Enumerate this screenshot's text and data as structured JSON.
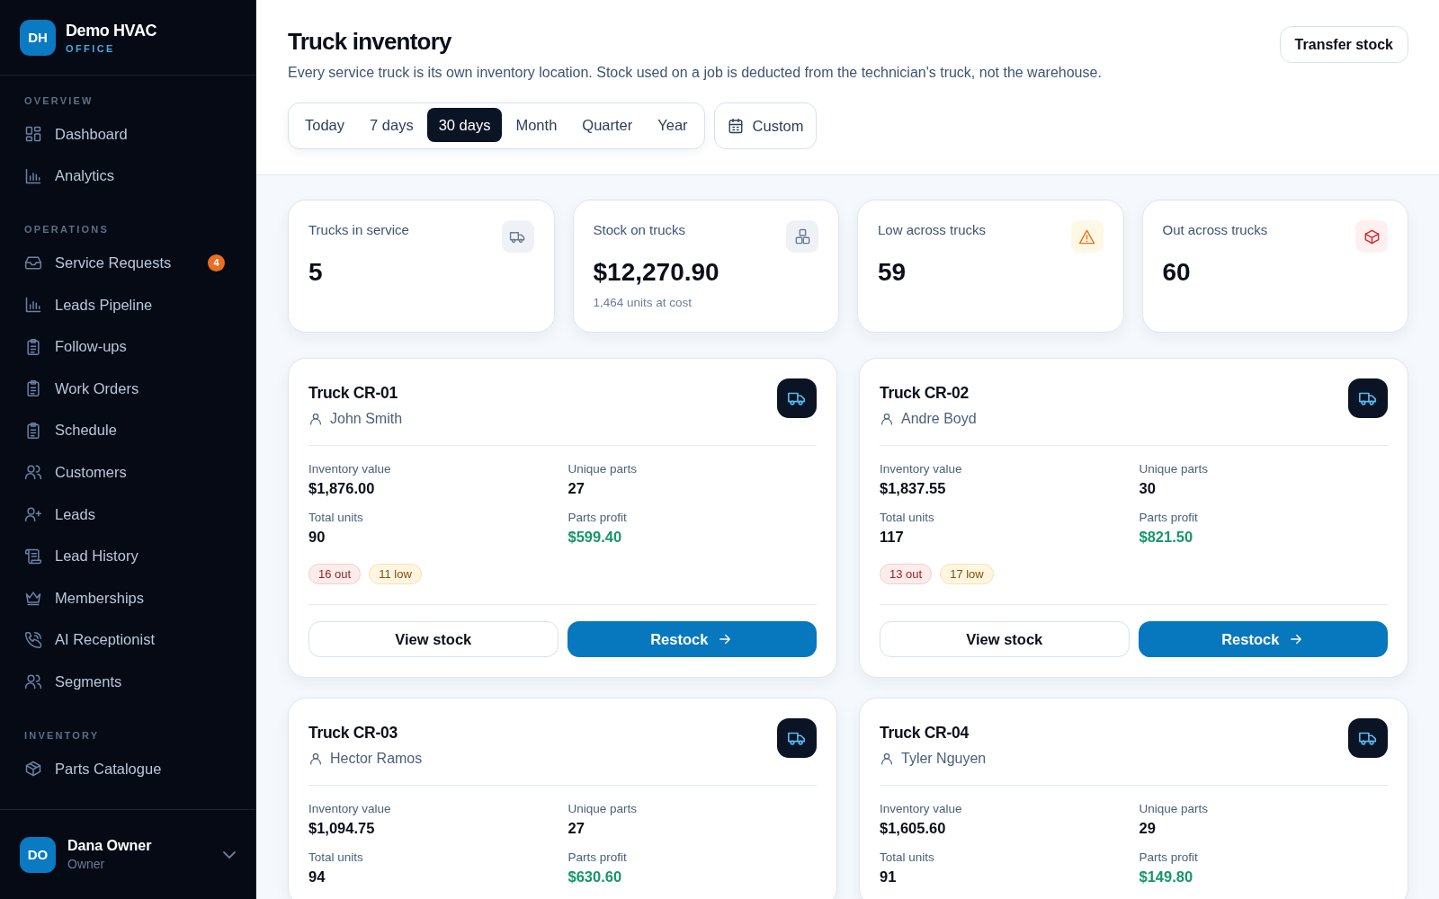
{
  "brand": {
    "initials": "DH",
    "name": "Demo HVAC",
    "subtitle": "OFFICE"
  },
  "sidebar": {
    "sections": [
      {
        "title": "OVERVIEW",
        "items": [
          {
            "label": "Dashboard",
            "kind": "grid"
          },
          {
            "label": "Analytics",
            "kind": "chart"
          }
        ]
      },
      {
        "title": "OPERATIONS",
        "items": [
          {
            "label": "Service Requests",
            "kind": "inbox",
            "badge": "4"
          },
          {
            "label": "Leads Pipeline",
            "kind": "chart"
          },
          {
            "label": "Follow-ups",
            "kind": "clipboard"
          },
          {
            "label": "Work Orders",
            "kind": "clipboard"
          },
          {
            "label": "Schedule",
            "kind": "clipboard"
          },
          {
            "label": "Customers",
            "kind": "users"
          },
          {
            "label": "Leads",
            "kind": "userplus"
          },
          {
            "label": "Lead History",
            "kind": "scroll"
          },
          {
            "label": "Memberships",
            "kind": "crown"
          },
          {
            "label": "AI Receptionist",
            "kind": "phone"
          },
          {
            "label": "Segments",
            "kind": "users"
          }
        ]
      },
      {
        "title": "INVENTORY",
        "items": [
          {
            "label": "Parts Catalogue",
            "kind": "box"
          }
        ]
      }
    ]
  },
  "user": {
    "initials": "DO",
    "name": "Dana Owner",
    "role": "Owner"
  },
  "header": {
    "title": "Truck inventory",
    "description": "Every service truck is its own inventory location. Stock used on a job is deducted from the technician's truck, not the warehouse.",
    "action": "Transfer stock",
    "custom": "Custom"
  },
  "ranges": [
    {
      "label": "Today",
      "selected": false
    },
    {
      "label": "7 days",
      "selected": false
    },
    {
      "label": "30 days",
      "selected": true
    },
    {
      "label": "Month",
      "selected": false
    },
    {
      "label": "Quarter",
      "selected": false
    },
    {
      "label": "Year",
      "selected": false
    }
  ],
  "stats": [
    {
      "label": "Trucks in service",
      "value": "5",
      "kind": "truck"
    },
    {
      "label": "Stock on trucks",
      "value": "$12,270.90",
      "note": "1,464 units at cost",
      "kind": "boxes"
    },
    {
      "label": "Low across trucks",
      "value": "59",
      "kind": "warning"
    },
    {
      "label": "Out across trucks",
      "value": "60",
      "kind": "package"
    }
  ],
  "trucks": [
    {
      "name": "Truck CR-01",
      "driver": "John Smith",
      "fields": [
        {
          "label": "Inventory value",
          "value": "$1,876.00",
          "kind": "plain"
        },
        {
          "label": "Unique parts",
          "value": "27",
          "kind": "plain"
        },
        {
          "label": "Total units",
          "value": "90",
          "kind": "plain"
        },
        {
          "label": "Parts profit",
          "value": "$599.40",
          "kind": "profit"
        }
      ],
      "tags": [
        {
          "text": "16 out",
          "kind": "out"
        },
        {
          "text": "11 low",
          "kind": "low"
        }
      ],
      "buttons": [
        {
          "label": "View stock",
          "kind": "secondary"
        },
        {
          "label": "Restock",
          "kind": "primary"
        }
      ]
    },
    {
      "name": "Truck CR-02",
      "driver": "Andre Boyd",
      "fields": [
        {
          "label": "Inventory value",
          "value": "$1,837.55",
          "kind": "plain"
        },
        {
          "label": "Unique parts",
          "value": "30",
          "kind": "plain"
        },
        {
          "label": "Total units",
          "value": "117",
          "kind": "plain"
        },
        {
          "label": "Parts profit",
          "value": "$821.50",
          "kind": "profit"
        }
      ],
      "tags": [
        {
          "text": "13 out",
          "kind": "out"
        },
        {
          "text": "17 low",
          "kind": "low"
        }
      ],
      "buttons": [
        {
          "label": "View stock",
          "kind": "secondary"
        },
        {
          "label": "Restock",
          "kind": "primary"
        }
      ]
    },
    {
      "name": "Truck CR-03",
      "driver": "Hector Ramos",
      "fields": [
        {
          "label": "Inventory value",
          "value": "$1,094.75",
          "kind": "plain"
        },
        {
          "label": "Unique parts",
          "value": "27",
          "kind": "plain"
        },
        {
          "label": "Total units",
          "value": "94",
          "kind": "plain"
        },
        {
          "label": "Parts profit",
          "value": "$630.60",
          "kind": "profit"
        }
      ]
    },
    {
      "name": "Truck CR-04",
      "driver": "Tyler Nguyen",
      "fields": [
        {
          "label": "Inventory value",
          "value": "$1,605.60",
          "kind": "plain"
        },
        {
          "label": "Unique parts",
          "value": "29",
          "kind": "plain"
        },
        {
          "label": "Total units",
          "value": "91",
          "kind": "plain"
        },
        {
          "label": "Parts profit",
          "value": "$149.80",
          "kind": "profit"
        }
      ]
    }
  ]
}
